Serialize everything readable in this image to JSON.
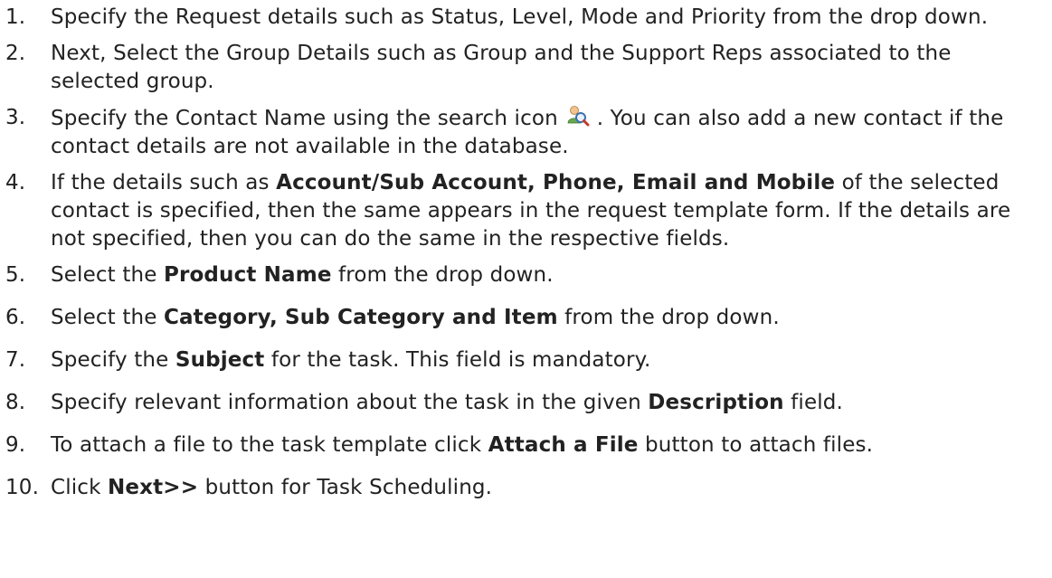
{
  "steps": [
    {
      "num": "1.",
      "parts": [
        "Specify the Request details such as Status, Level, Mode and Priority from the drop down."
      ]
    },
    {
      "num": "2.",
      "parts": [
        "Next, Select the Group Details such as Group and the Support Reps associated to the selected group."
      ]
    },
    {
      "num": "3.",
      "before_icon": "Specify the Contact Name using the search icon ",
      "icon": "search-user-icon",
      "after_icon": " . You can also add a new contact if the contact details are not available in the database."
    },
    {
      "num": "4.",
      "pre": "If the details such as ",
      "bold": "Account/Sub Account, Phone, Email and Mobile",
      "post": " of the selected contact is specified, then the same appears in the request template form. If the details are not specified, then you can do the same in the respective fields."
    },
    {
      "num": "5.",
      "pre": "Select the ",
      "bold": "Product Name",
      "post": " from the drop down."
    },
    {
      "num": "6.",
      "pre": "Select the ",
      "bold": "Category, Sub Category and Item",
      "post": " from the drop down."
    },
    {
      "num": "7.",
      "pre": "Specify the ",
      "bold": "Subject",
      "post": " for the task. This field is mandatory."
    },
    {
      "num": "8.",
      "pre": "Specify relevant information about the task in the given ",
      "bold": "Description",
      "post": " field."
    },
    {
      "num": "9.",
      "pre": "To attach a file to the task template click ",
      "bold": "Attach a File",
      "post": " button to attach files."
    },
    {
      "num": "10.",
      "pre": "Click ",
      "bold": "Next>>",
      "post": " button for Task Scheduling."
    }
  ],
  "colors": {
    "text": "#222222",
    "icon_user": "#6aa84f",
    "icon_lens": "#3a6fb0"
  }
}
